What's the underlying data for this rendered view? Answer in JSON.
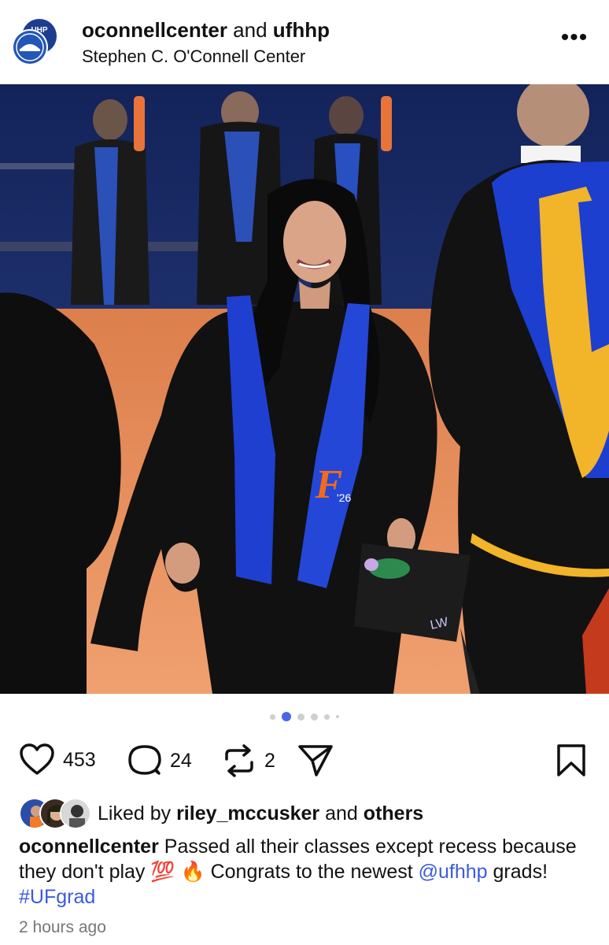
{
  "post": {
    "author_primary": "oconnellcenter",
    "author_joiner": "and",
    "author_secondary": "ufhhp",
    "location": "Stephen C. O'Connell Center",
    "avatar_badge_text": "UHP",
    "more_label": "•••"
  },
  "photo": {
    "stole_letter": "F",
    "stole_year": "'26",
    "cap_text": "LW"
  },
  "carousel": {
    "count": 6,
    "active_index": 1
  },
  "actions": {
    "likes": "453",
    "comments": "24",
    "reposts": "2"
  },
  "liked_by": {
    "prefix": "Liked by",
    "user": "riley_mccusker",
    "joiner": "and",
    "others": "others"
  },
  "caption": {
    "username": "oconnellcenter",
    "text_1": "Passed all their classes except recess because they don't play",
    "emoji_1": "💯",
    "emoji_2": "🔥",
    "text_2": "Congrats to the newest",
    "mention": "@ufhhp",
    "text_3": "grads!",
    "hashtag": "#UFgrad"
  },
  "timestamp": "2 hours ago",
  "colors": {
    "link": "#3b5bdb",
    "carousel_active": "#4a67e8",
    "stole_blue": "#1f3fd0",
    "floor_orange": "#e88a55",
    "gown_black": "#141414"
  }
}
